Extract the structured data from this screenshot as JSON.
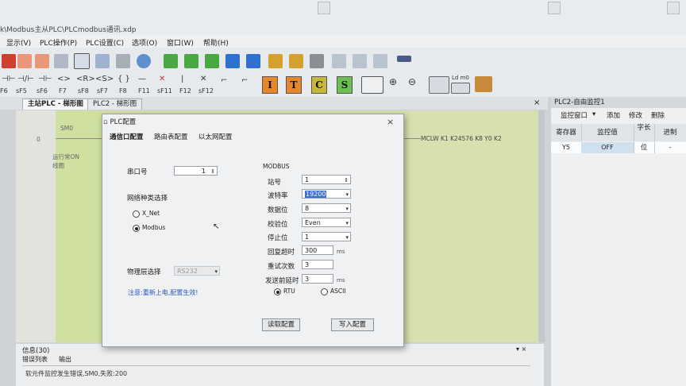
{
  "window": {
    "title": "k\\Modbus主从PLC\\PLCmodbus通讯.xdp"
  },
  "menu": [
    "显示(V)",
    "PLC操作(P)",
    "PLC设置(C)",
    "选项(O)",
    "窗口(W)",
    "帮助(H)"
  ],
  "toolbar2_labels": [
    "F6",
    "sF5",
    "sF6",
    "F7",
    "sF8",
    "sF7",
    "F8",
    "F11",
    "sF11",
    "F12",
    "sF12"
  ],
  "toolbar2_boxes": [
    "I",
    "T",
    "C",
    "S"
  ],
  "tabs": [
    "主站PLC - 梯形图",
    "PLC2 - 梯形图"
  ],
  "ladder": {
    "row_number": "0",
    "contact_label": "SM0",
    "contact_comment": "运行常ON线圈",
    "coil_instruction": "MCLW K1 K24576 K8 Y0 K2"
  },
  "monitor": {
    "title": "PLC2-自由监控1",
    "tools": [
      "监控窗口",
      "添加",
      "修改",
      "删除"
    ],
    "headers": [
      "寄存器",
      "监控值",
      "字长",
      "进制"
    ],
    "row": {
      "register": "Y5",
      "value": "OFF",
      "length": "位",
      "base": "-"
    }
  },
  "info": {
    "title": "信息(30)",
    "tabs": [
      "错误列表",
      "输出"
    ],
    "message": "软元件监控发生错误,SM0,失败:200"
  },
  "dialog": {
    "title": "PLC配置",
    "close": "×",
    "tabs": [
      "通信口配置",
      "路由表配置",
      "以太网配置"
    ],
    "serial_label": "串口号",
    "serial_value": "1",
    "net_type_label": "网络种类选择",
    "net_options": [
      "X_Net",
      "Modbus"
    ],
    "phys_label": "物理层选择",
    "phys_value": "RS232",
    "note": "注意:重新上电,配置生效!",
    "modbus_title": "MODBUS",
    "station_label": "站号",
    "station_value": "1",
    "baud_label": "波特率",
    "baud_value": "19200",
    "databits_label": "数据位",
    "databits_value": "8",
    "parity_label": "校验位",
    "parity_value": "Even",
    "stopbits_label": "停止位",
    "stopbits_value": "1",
    "timeout_label": "回复超时",
    "timeout_value": "300",
    "timeout_unit": "ms",
    "retry_label": "重试次数",
    "retry_value": "3",
    "delay_label": "发送前延时",
    "delay_value": "3",
    "delay_unit": "ms",
    "mode_options": [
      "RTU",
      "ASCII"
    ],
    "read_button": "读取配置",
    "write_button": "写入配置"
  }
}
